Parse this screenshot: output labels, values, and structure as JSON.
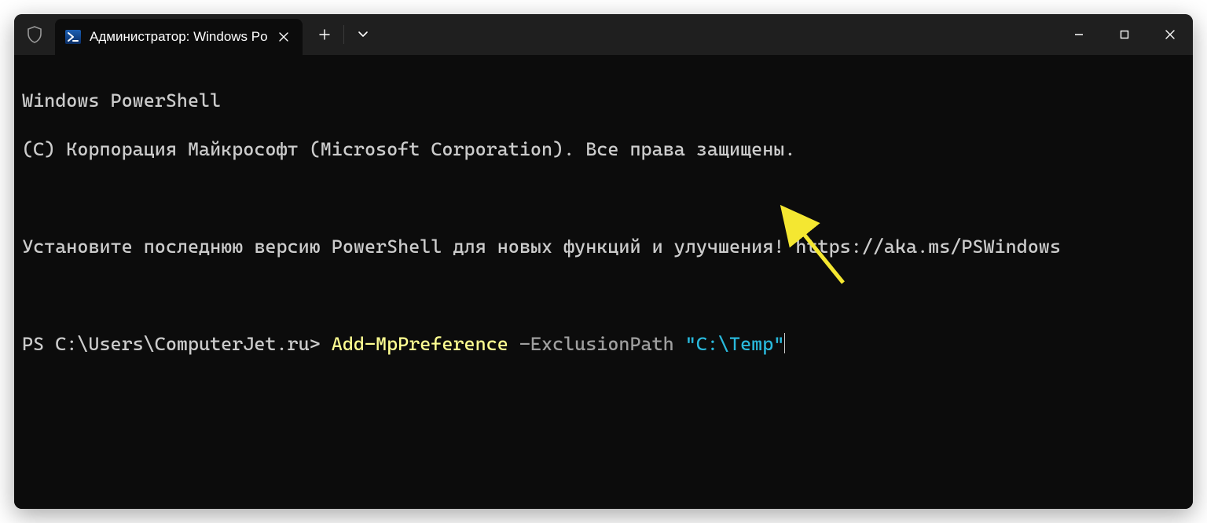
{
  "window": {
    "tab_title": "Администратор: Windows Po"
  },
  "terminal": {
    "banner_line1": "Windows PowerShell",
    "banner_line2": "(C) Корпорация Майкрософт (Microsoft Corporation). Все права защищены.",
    "hint_line": "Установите последнюю версию PowerShell для новых функций и улучшения! https://aka.ms/PSWindows",
    "prompt": "PS C:\\Users\\ComputerJet.ru> ",
    "cmdlet": "Add-MpPreference",
    "param": " -ExclusionPath ",
    "argument": "\"C:\\Temp\""
  },
  "icons": {
    "shield": "shield-icon",
    "powershell": "powershell-icon",
    "close_tab": "close-icon",
    "new_tab": "plus-icon",
    "tab_menu": "chevron-down-icon",
    "minimize": "minimize-icon",
    "maximize": "maximize-icon",
    "window_close": "close-icon"
  },
  "annotation": {
    "color": "#f4e731"
  }
}
